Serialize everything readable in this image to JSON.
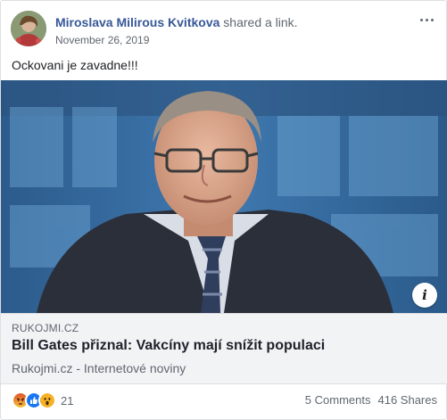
{
  "post": {
    "author": "Miroslava Milirous Kvitkova",
    "action": "shared a link.",
    "date": "November 26, 2019",
    "text": "Ockovani je zavadne!!!"
  },
  "link": {
    "domain": "RUKOJMI.CZ",
    "title": "Bill Gates přiznal: Vakcíny mají snížit populaci",
    "description": "Rukojmi.cz - Internetové noviny",
    "info_icon": "i"
  },
  "footer": {
    "reaction_icons": [
      "angry-icon",
      "like-icon",
      "wow-icon"
    ],
    "reaction_count": "21",
    "comments": "5 Comments",
    "shares": "416 Shares"
  },
  "colors": {
    "author": "#385898",
    "meta_bg": "#f2f3f5",
    "secondary_text": "#606770",
    "like": "#1877f2",
    "angry": "#e9710f",
    "wow": "#f7b125"
  }
}
